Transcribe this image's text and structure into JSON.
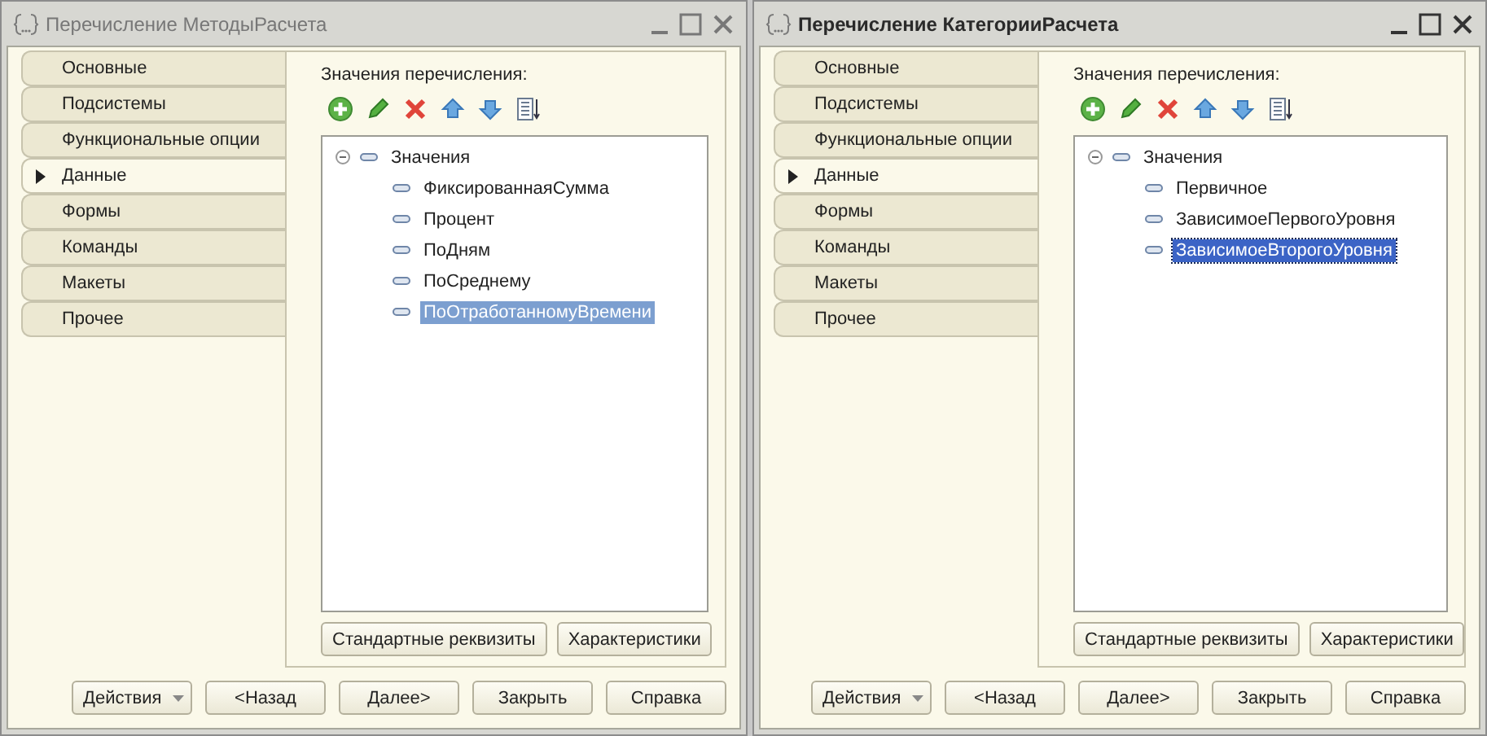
{
  "windows": [
    {
      "title": "Перечисление МетодыРасчета",
      "active": false,
      "tabs": [
        {
          "label": "Основные",
          "selected": false
        },
        {
          "label": "Подсистемы",
          "selected": false
        },
        {
          "label": "Функциональные опции",
          "selected": false
        },
        {
          "label": "Данные",
          "selected": true
        },
        {
          "label": "Формы",
          "selected": false
        },
        {
          "label": "Команды",
          "selected": false
        },
        {
          "label": "Макеты",
          "selected": false
        },
        {
          "label": "Прочее",
          "selected": false
        }
      ],
      "list_label": "Значения перечисления:",
      "tree": {
        "label": "Значения",
        "expanded": true,
        "children": [
          {
            "label": "ФиксированнаяСумма",
            "selected": false
          },
          {
            "label": "Процент",
            "selected": false
          },
          {
            "label": "ПоДням",
            "selected": false
          },
          {
            "label": "ПоСреднему",
            "selected": false
          },
          {
            "label": "ПоОтработанномуВремени",
            "selected": true
          }
        ]
      },
      "panel_buttons": [
        "Стандартные реквизиты",
        "Характеристики"
      ],
      "footer_buttons": [
        {
          "label": "Действия",
          "kind": "dropdown"
        },
        {
          "label": "<Назад",
          "kind": "plain"
        },
        {
          "label": "Далее>",
          "kind": "plain"
        },
        {
          "label": "Закрыть",
          "kind": "plain"
        },
        {
          "label": "Справка",
          "kind": "plain"
        }
      ]
    },
    {
      "title": "Перечисление КатегорииРасчета",
      "active": true,
      "tabs": [
        {
          "label": "Основные",
          "selected": false
        },
        {
          "label": "Подсистемы",
          "selected": false
        },
        {
          "label": "Функциональные опции",
          "selected": false
        },
        {
          "label": "Данные",
          "selected": true
        },
        {
          "label": "Формы",
          "selected": false
        },
        {
          "label": "Команды",
          "selected": false
        },
        {
          "label": "Макеты",
          "selected": false
        },
        {
          "label": "Прочее",
          "selected": false
        }
      ],
      "list_label": "Значения перечисления:",
      "tree": {
        "label": "Значения",
        "expanded": true,
        "children": [
          {
            "label": "Первичное",
            "selected": false
          },
          {
            "label": "ЗависимоеПервогоУровня",
            "selected": false
          },
          {
            "label": "ЗависимоеВторогоУровня",
            "selected": true
          }
        ]
      },
      "panel_buttons": [
        "Стандартные реквизиты",
        "Характеристики"
      ],
      "footer_buttons": [
        {
          "label": "Действия",
          "kind": "dropdown"
        },
        {
          "label": "<Назад",
          "kind": "plain"
        },
        {
          "label": "Далее>",
          "kind": "plain"
        },
        {
          "label": "Закрыть",
          "kind": "plain"
        },
        {
          "label": "Справка",
          "kind": "plain"
        }
      ]
    }
  ]
}
